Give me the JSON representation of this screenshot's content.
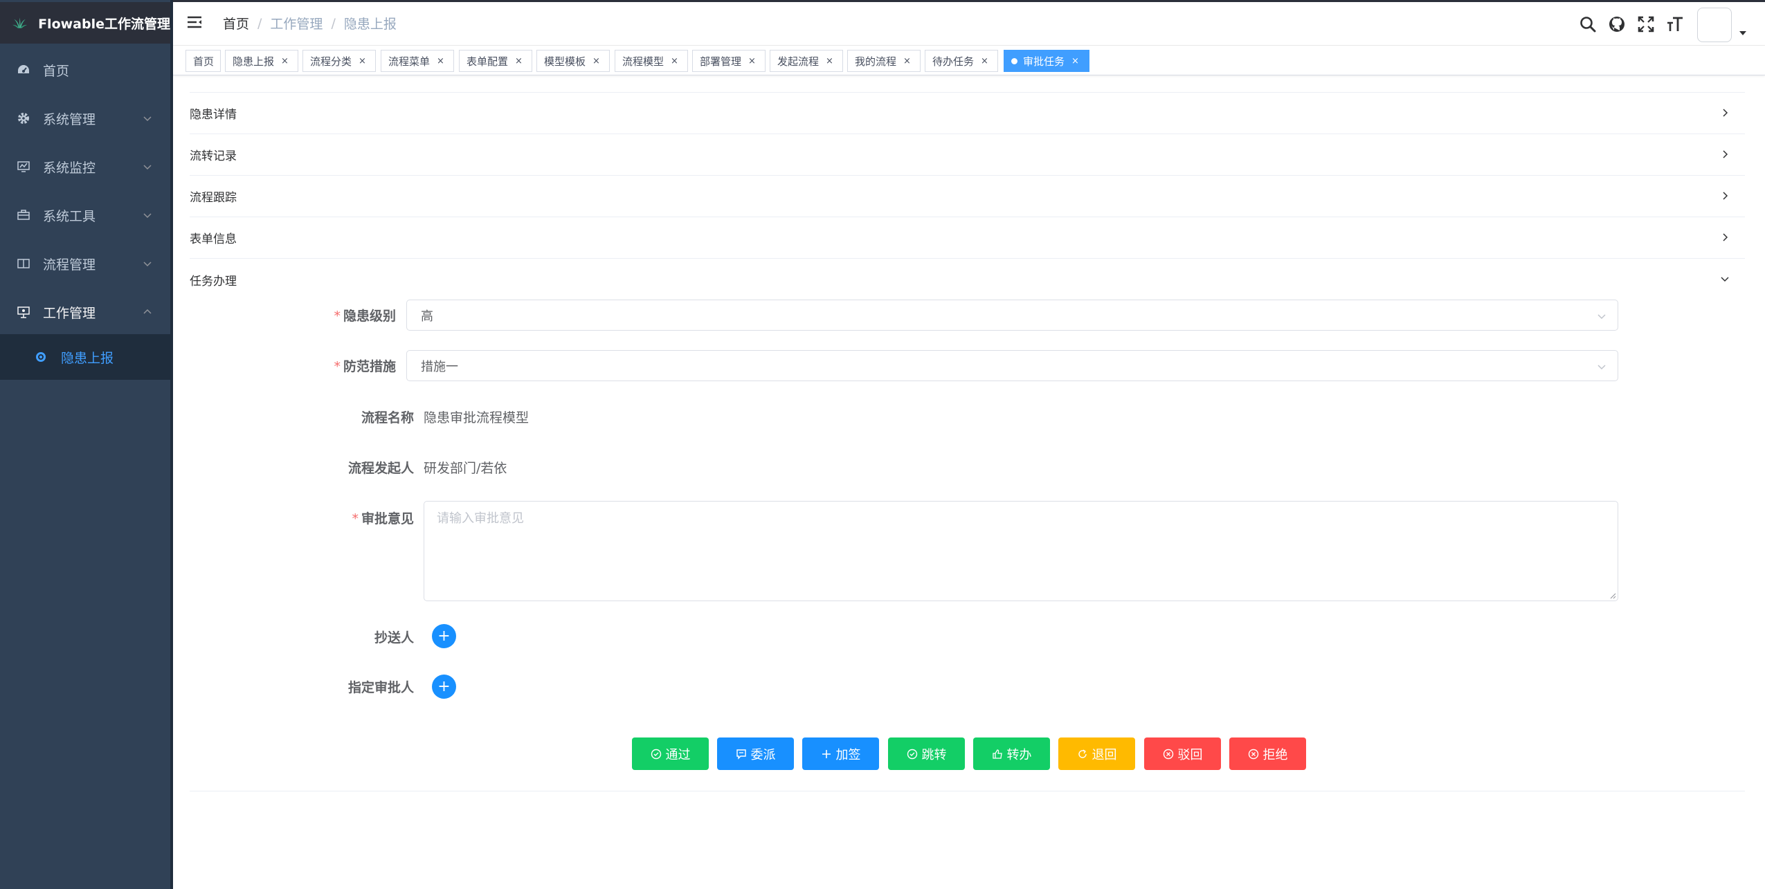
{
  "app": {
    "title": "Flowable工作流管理",
    "accent_color": "#409eff",
    "sidebar_bg": "#304156"
  },
  "sidebar": {
    "items": [
      {
        "label": "首页",
        "icon": "dashboard-icon"
      },
      {
        "label": "系统管理",
        "icon": "gear-icon"
      },
      {
        "label": "系统监控",
        "icon": "monitor-icon"
      },
      {
        "label": "系统工具",
        "icon": "toolbox-icon"
      },
      {
        "label": "流程管理",
        "icon": "book-icon"
      },
      {
        "label": "工作管理",
        "icon": "presentation-icon"
      }
    ],
    "submenu_label": "隐患上报"
  },
  "breadcrumb": [
    "首页",
    "工作管理",
    "隐患上报"
  ],
  "tags": [
    {
      "label": "首页"
    },
    {
      "label": "隐患上报",
      "close": "×"
    },
    {
      "label": "流程分类",
      "close": "×"
    },
    {
      "label": "流程菜单",
      "close": "×"
    },
    {
      "label": "表单配置",
      "close": "×"
    },
    {
      "label": "模型模板",
      "close": "×"
    },
    {
      "label": "流程模型",
      "close": "×"
    },
    {
      "label": "部署管理",
      "close": "×"
    },
    {
      "label": "发起流程",
      "close": "×"
    },
    {
      "label": "我的流程",
      "close": "×"
    },
    {
      "label": "待办任务",
      "close": "×"
    },
    {
      "label": "审批任务",
      "close": "×"
    }
  ],
  "collapse": {
    "rows": [
      "隐患详情",
      "流转记录",
      "流程跟踪",
      "表单信息",
      "任务办理"
    ]
  },
  "form": {
    "hazard_level_label": "隐患级别",
    "hazard_level_value": "高",
    "prevention_label": "防范措施",
    "prevention_value": "措施一",
    "process_name_label": "流程名称",
    "process_name_value": "隐患审批流程模型",
    "initiator_label": "流程发起人",
    "initiator_value": "研发部门/若依",
    "opinion_label": "审批意见",
    "opinion_placeholder": "请输入审批意见",
    "cc_label": "抄送人",
    "approver_label": "指定审批人",
    "required_mark": "*",
    "add_symbol": "+"
  },
  "actions": {
    "pass": "通过",
    "delegate": "委派",
    "add_sign": "加签",
    "jump": "跳转",
    "transfer": "转办",
    "return": "退回",
    "reject_back": "驳回",
    "refuse": "拒绝"
  }
}
